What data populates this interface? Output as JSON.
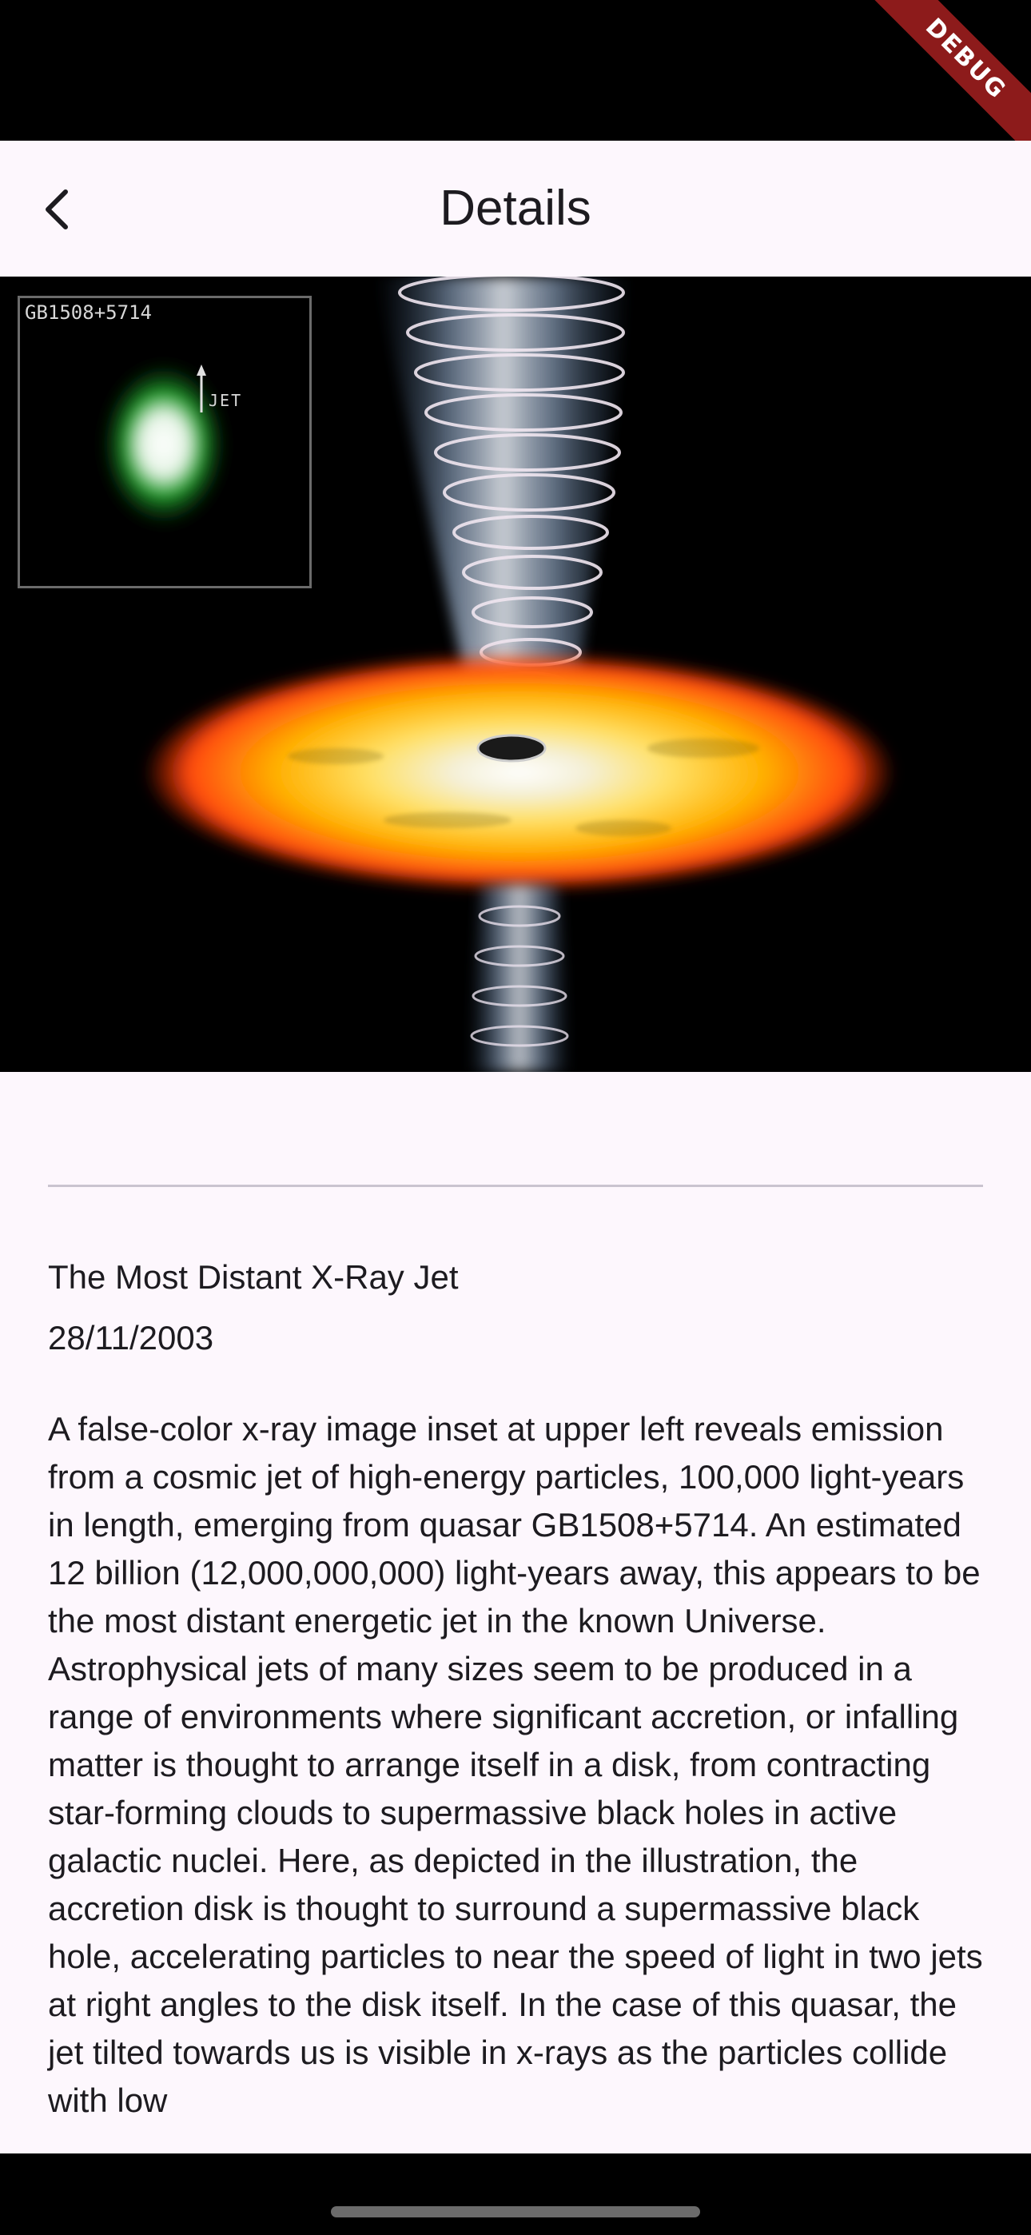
{
  "debug_banner": "DEBUG",
  "app_bar": {
    "title": "Details",
    "back_icon": "chevron-left-icon"
  },
  "hero_image": {
    "inset_label": "GB1508+5714",
    "jet_label": "JET",
    "colors": {
      "background": "#000000",
      "disk_outer": "#ff4a10",
      "disk_mid": "#ffb000",
      "disk_inner": "#ffe066",
      "jet": "#dfe8f5",
      "inset_glow": "#1f9e2a"
    }
  },
  "item": {
    "title": "The Most Distant X-Ray Jet",
    "date": "28/11/2003",
    "description": "A false-color x-ray image inset at upper left reveals emission from a cosmic jet of high-energy particles, 100,000 light-years in length, emerging from quasar GB1508+5714. An estimated 12 billion (12,000,000,000) light-years away, this appears to be the most distant energetic jet in the known Universe. Astrophysical jets of many sizes seem to be produced in a range of environments where significant accretion, or infalling matter is thought to arrange itself in a disk, from contracting star-forming clouds to supermassive black holes in active galactic nuclei. Here, as depicted in the illustration, the accretion disk is thought to surround a supermassive black hole, accelerating particles to near the speed of light in two jets at right angles to the disk itself. In the case of this quasar, the jet tilted towards us is visible in x-rays as the particles collide with low"
  },
  "theme": {
    "surface": "#fdf7fd",
    "on_surface": "#1d1b20",
    "divider": "#cac4d0",
    "debug_ribbon": "#8d1b1b"
  }
}
